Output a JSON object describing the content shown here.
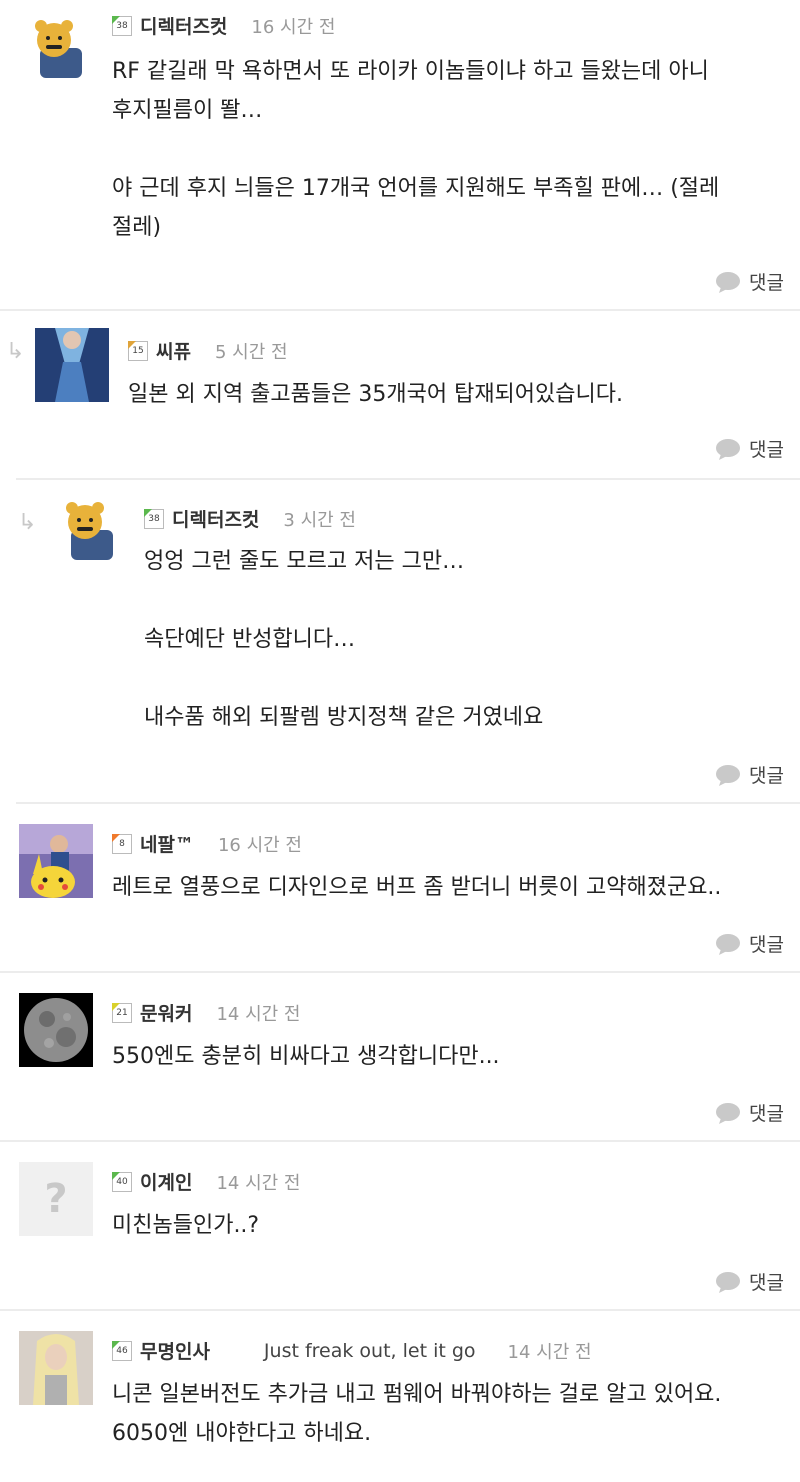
{
  "reply_label": "댓글",
  "comments": [
    {
      "level": "38",
      "nick": "디렉터즈컷",
      "time": "16 시간 전",
      "body": "RF 같길래 막 욕하면서 또 라이카 이놈들이냐 하고 들왔는데 아니\n후지필름이 똴…\n\n야 근데 후지 늬들은 17개국 언어를 지원해도 부족힐 판에… (절레\n절레)",
      "avatar": "bear-avatar",
      "level_color": "#5bb84d"
    },
    {
      "level": "15",
      "nick": "씨퓨",
      "time": "5 시간 전",
      "body": "일본 외 지역 출고품들은 35개국어 탑재되어있습니다.",
      "avatar": "scarf-avatar",
      "level_color": "#e0a43a"
    },
    {
      "level": "38",
      "nick": "디렉터즈컷",
      "time": "3 시간 전",
      "body": "엉엉 그런 줄도 모르고 저는 그만…\n\n속단예단 반성합니다…\n\n내수품 해외 되팔렘 방지정책 같은 거였네요",
      "avatar": "bear-avatar",
      "level_color": "#5bb84d"
    },
    {
      "level": "8",
      "nick": "네팔™",
      "time": "16 시간 전",
      "body": "레트로 열풍으로 디자인으로 버프 좀 받더니 버릇이 고약해졌군요..",
      "avatar": "pikachu-avatar",
      "level_color": "#f07a2c"
    },
    {
      "level": "21",
      "nick": "문워커",
      "time": "14 시간 전",
      "body": "550엔도 충분히 비싸다고 생각합니다만...",
      "avatar": "moon-avatar",
      "level_color": "#d9d12a"
    },
    {
      "level": "40",
      "nick": "이계인",
      "time": "14 시간 전",
      "body": "미친놈들인가..?",
      "avatar": "default-avatar",
      "avatar_text": "?",
      "level_color": "#5bb84d"
    },
    {
      "level": "46",
      "nick": "무명인사",
      "status": "Just freak out, let it go",
      "time": "14 시간 전",
      "body": "니콘 일본버전도 추가금 내고 펌웨어 바꿔야하는 걸로 알고 있어요.\n6050엔 내야한다고 하네요.",
      "avatar": "person-avatar",
      "level_color": "#5bb84d"
    }
  ]
}
